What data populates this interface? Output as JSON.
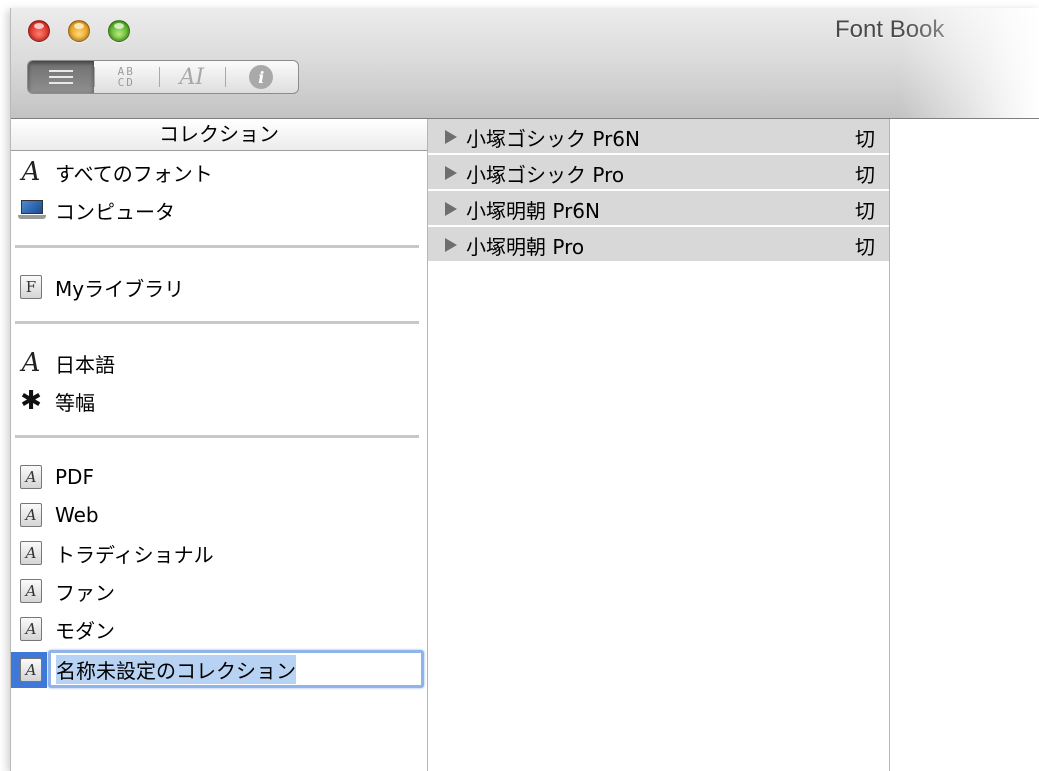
{
  "window": {
    "title": "Font Book"
  },
  "toolbar": {
    "view_buttons": [
      {
        "name": "list-view",
        "icon": "list-icon"
      },
      {
        "name": "sample-view",
        "icon": "abcd-icon",
        "label": "AB CD"
      },
      {
        "name": "custom-view",
        "icon": "ai-icon",
        "label": "AI"
      },
      {
        "name": "info-view",
        "icon": "info-icon",
        "label": "i"
      }
    ]
  },
  "sidebar": {
    "header": "コレクション",
    "items": [
      {
        "label": "すべてのフォント",
        "icon": "script-a-icon",
        "glyph": "A"
      },
      {
        "label": "コンピュータ",
        "icon": "laptop-icon"
      },
      {
        "label": "Myライブラリ",
        "icon": "library-f-icon",
        "glyph": "F"
      },
      {
        "label": "日本語",
        "icon": "script-a-icon",
        "glyph": "A"
      },
      {
        "label": "等幅",
        "icon": "gear-icon",
        "glyph": "✱"
      },
      {
        "label": "PDF",
        "icon": "collection-icon",
        "glyph": "A"
      },
      {
        "label": "Web",
        "icon": "collection-icon",
        "glyph": "A"
      },
      {
        "label": "トラディショナル",
        "icon": "collection-icon",
        "glyph": "A"
      },
      {
        "label": "ファン",
        "icon": "collection-icon",
        "glyph": "A"
      },
      {
        "label": "モダン",
        "icon": "collection-icon",
        "glyph": "A"
      },
      {
        "label": "名称未設定のコレクション",
        "icon": "collection-icon",
        "glyph": "A",
        "editing": true
      }
    ]
  },
  "fonts": {
    "rows": [
      {
        "name": "小塚ゴシック Pr6N",
        "status": "切"
      },
      {
        "name": "小塚ゴシック Pro",
        "status": "切"
      },
      {
        "name": "小塚明朝 Pr6N",
        "status": "切"
      },
      {
        "name": "小塚明朝 Pro",
        "status": "切"
      }
    ]
  },
  "colors": {
    "selection": "#3f78d6",
    "rename_focus": "#8fb4ea",
    "text_selection": "#b7d2f3",
    "row_bg": "#d8d8d8"
  }
}
